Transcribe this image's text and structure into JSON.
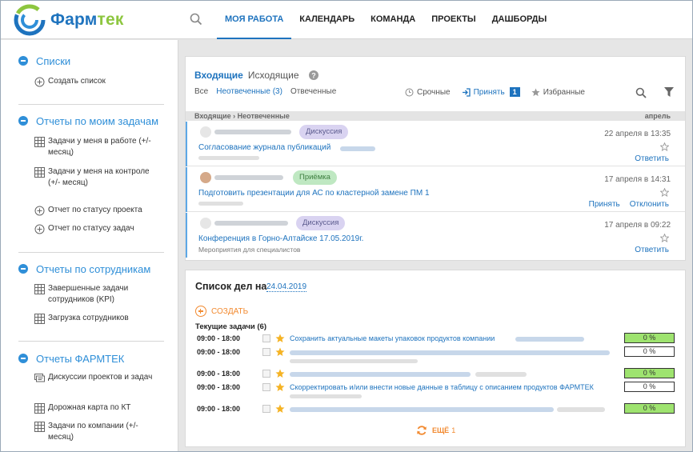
{
  "header": {
    "logo_text": "Фарм",
    "logo_accent": "тек",
    "nav": [
      "Моя работа",
      "Календарь",
      "Команда",
      "Проекты",
      "Дашборды"
    ],
    "active_nav": "Моя работа"
  },
  "sidebar": {
    "sections": [
      {
        "title": "Списки",
        "items": [
          {
            "label": "Создать список",
            "icon": "plus-circle-icon"
          }
        ]
      },
      {
        "title": "Отчеты по моим задачам",
        "items": [
          {
            "label": "Задачи у меня в работе (+/- месяц)",
            "icon": "table-icon"
          },
          {
            "label": "Задачи у меня на контроле (+/- месяц)",
            "icon": "table-icon"
          },
          {
            "label": "Отчет по статусу проекта",
            "icon": "plus-circle-icon"
          },
          {
            "label": "Отчет по статусу задач",
            "icon": "plus-circle-icon"
          }
        ]
      },
      {
        "title": "Отчеты по сотрудникам",
        "items": [
          {
            "label": "Завершенные задачи сотрудников (KPI)",
            "icon": "table-icon"
          },
          {
            "label": "Загрузка сотрудников",
            "icon": "table-icon"
          }
        ]
      },
      {
        "title": "Отчеты ФАРМТЕК",
        "items": [
          {
            "label": "Дискуссии проектов и задач",
            "icon": "discussion-icon"
          },
          {
            "label": "Дорожная карта по КТ",
            "icon": "table-icon"
          },
          {
            "label": "Задачи по компании (+/- месяц)",
            "icon": "table-icon"
          }
        ]
      }
    ]
  },
  "inbox": {
    "tabs": {
      "incoming": "Входящие",
      "outgoing": "Исходящие"
    },
    "filters": {
      "all": "Все",
      "unanswered": "Неотвеченные (3)",
      "answered": "Отвеченные"
    },
    "actions": {
      "urgent": "Срочные",
      "accept": "Принять",
      "accept_count": "1",
      "favorites": "Избранные"
    },
    "breadcrumb": {
      "root": "Входящие",
      "sep": "›",
      "current": "Неотвеченные",
      "month": "апрель"
    },
    "rows": [
      {
        "tag": "Дискуссия",
        "date": "22 апреля в 13:35",
        "title": "Согласование журнала публикаций",
        "sub": "",
        "actions": [
          "Ответить"
        ]
      },
      {
        "tag": "Приёмка",
        "date": "17 апреля в 14:31",
        "title": "Подготовить презентации для АС по кластерной замене ПМ 1",
        "sub": "",
        "actions": [
          "Принять",
          "Отклонить"
        ]
      },
      {
        "tag": "Дискуссия",
        "date": "17 апреля в 09:22",
        "title": "Конференция в Горно-Алтайске 17.05.2019г.",
        "sub": "Мероприятия для специалистов",
        "actions": [
          "Ответить"
        ]
      }
    ]
  },
  "todo": {
    "title": "Список дел на",
    "date": "24.04.2019",
    "create_label": "создать",
    "current_label": "Текущие задачи (6)",
    "tasks": [
      {
        "time": "09:00 - 18:00",
        "title": "Сохранить актуальные макеты упаковок продуктов компании",
        "progress_label": "0 %",
        "progress": 1
      },
      {
        "time": "09:00 - 18:00",
        "title": "",
        "progress_label": "0 %",
        "progress": 0
      },
      {
        "time": "09:00 - 18:00",
        "title": "",
        "progress_label": "0 %",
        "progress": 1
      },
      {
        "time": "09:00 - 18:00",
        "title": "Скорректировать и/или внести новые данные в таблицу с описанием продуктов ФАРМТЕК",
        "progress_label": "0 %",
        "progress": 0
      },
      {
        "time": "09:00 - 18:00",
        "title": "",
        "progress_label": "0 %",
        "progress": 1
      }
    ],
    "more_label": "ещё",
    "more_count": "1"
  }
}
